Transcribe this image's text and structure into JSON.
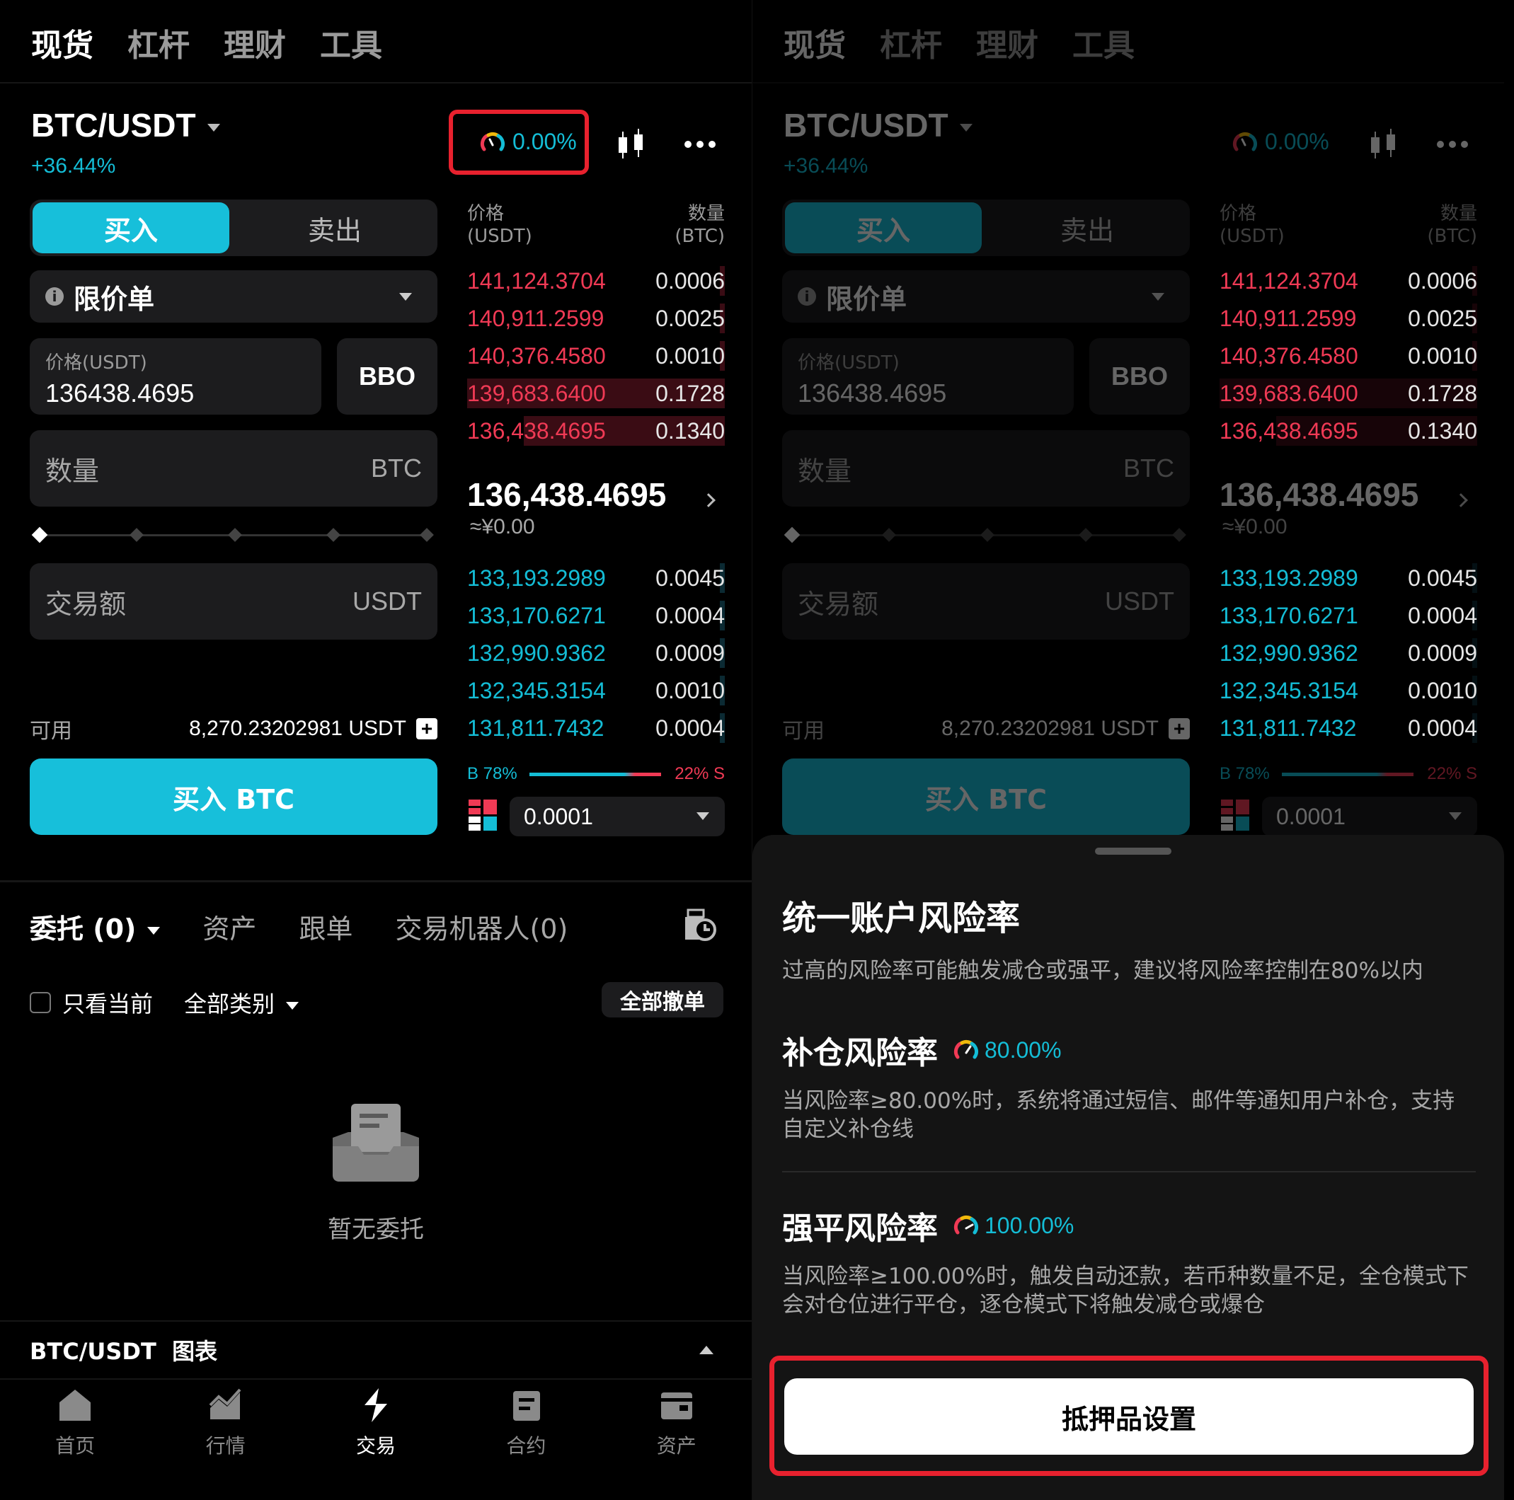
{
  "top_tabs": [
    "现货",
    "杠杆",
    "理财",
    "工具"
  ],
  "pair": "BTC/USDT",
  "change": "+36.44%",
  "risk_rate": "0.00%",
  "side_tabs": {
    "buy": "买入",
    "sell": "卖出"
  },
  "order_type": "限价单",
  "price_field": {
    "label": "价格(USDT)",
    "value": "136438.4695"
  },
  "bbo_label": "BBO",
  "quantity_field": {
    "label": "数量",
    "unit": "BTC"
  },
  "amount_field": {
    "label": "交易额",
    "unit": "USDT"
  },
  "available": {
    "label": "可用",
    "value": "8,270.23202981 USDT"
  },
  "buy_button": "买入 BTC",
  "orderbook": {
    "price_header": "价格",
    "price_unit": "(USDT)",
    "qty_header": "数量",
    "qty_unit": "(BTC)",
    "asks": [
      {
        "price": "141,124.3704",
        "qty": "0.0006",
        "depth": 0.01
      },
      {
        "price": "140,911.2599",
        "qty": "0.0025",
        "depth": 0.02
      },
      {
        "price": "140,376.4580",
        "qty": "0.0010",
        "depth": 0.01
      },
      {
        "price": "139,683.6400",
        "qty": "0.1728",
        "depth": 1.0
      },
      {
        "price": "136,438.4695",
        "qty": "0.1340",
        "depth": 0.78
      }
    ],
    "mid_price": "136,438.4695",
    "mid_fiat": "≈¥0.00",
    "bids": [
      {
        "price": "133,193.2989",
        "qty": "0.0045",
        "depth": 0.02
      },
      {
        "price": "133,170.6271",
        "qty": "0.0004",
        "depth": 0.01
      },
      {
        "price": "132,990.9362",
        "qty": "0.0009",
        "depth": 0.01
      },
      {
        "price": "132,345.3154",
        "qty": "0.0010",
        "depth": 0.01
      },
      {
        "price": "131,811.7432",
        "qty": "0.0004",
        "depth": 0.01
      }
    ],
    "buy_ratio": "B 78%",
    "sell_ratio": "22% S",
    "buy_ratio_value": 0.78,
    "depth_step": "0.0001"
  },
  "orders_tabs": [
    "委托 (0)",
    "资产",
    "跟单",
    "交易机器人(0)"
  ],
  "filter_current": "只看当前",
  "filter_category": "全部类别",
  "cancel_all": "全部撤单",
  "empty_text": "暂无委托",
  "chart_bar": "BTC/USDT  图表",
  "bottom_nav": [
    {
      "label": "首页",
      "icon": "home-icon"
    },
    {
      "label": "行情",
      "icon": "market-icon"
    },
    {
      "label": "交易",
      "icon": "trade-icon"
    },
    {
      "label": "合约",
      "icon": "contract-icon"
    },
    {
      "label": "资产",
      "icon": "wallet-icon"
    }
  ],
  "sheet": {
    "title": "统一账户风险率",
    "subtitle": "过高的风险率可能触发减仓或强平，建议将风险率控制在80%以内",
    "margin_call": {
      "title": "补仓风险率",
      "rate": "80.00%",
      "desc": "当风险率≥80.00%时，系统将通过短信、邮件等通知用户补仓，支持自定义补仓线"
    },
    "liquidation": {
      "title": "强平风险率",
      "rate": "100.00%",
      "desc": "当风险率≥100.00%时，触发自动还款，若币种数量不足，全仓模式下会对仓位进行平仓，逐仓模式下将触发减仓或爆仓"
    },
    "collateral_button": "抵押品设置"
  },
  "colors": {
    "accent": "#17bfda",
    "ask": "#f03a55",
    "bid": "#14bdd6",
    "highlight": "#e8212e"
  }
}
